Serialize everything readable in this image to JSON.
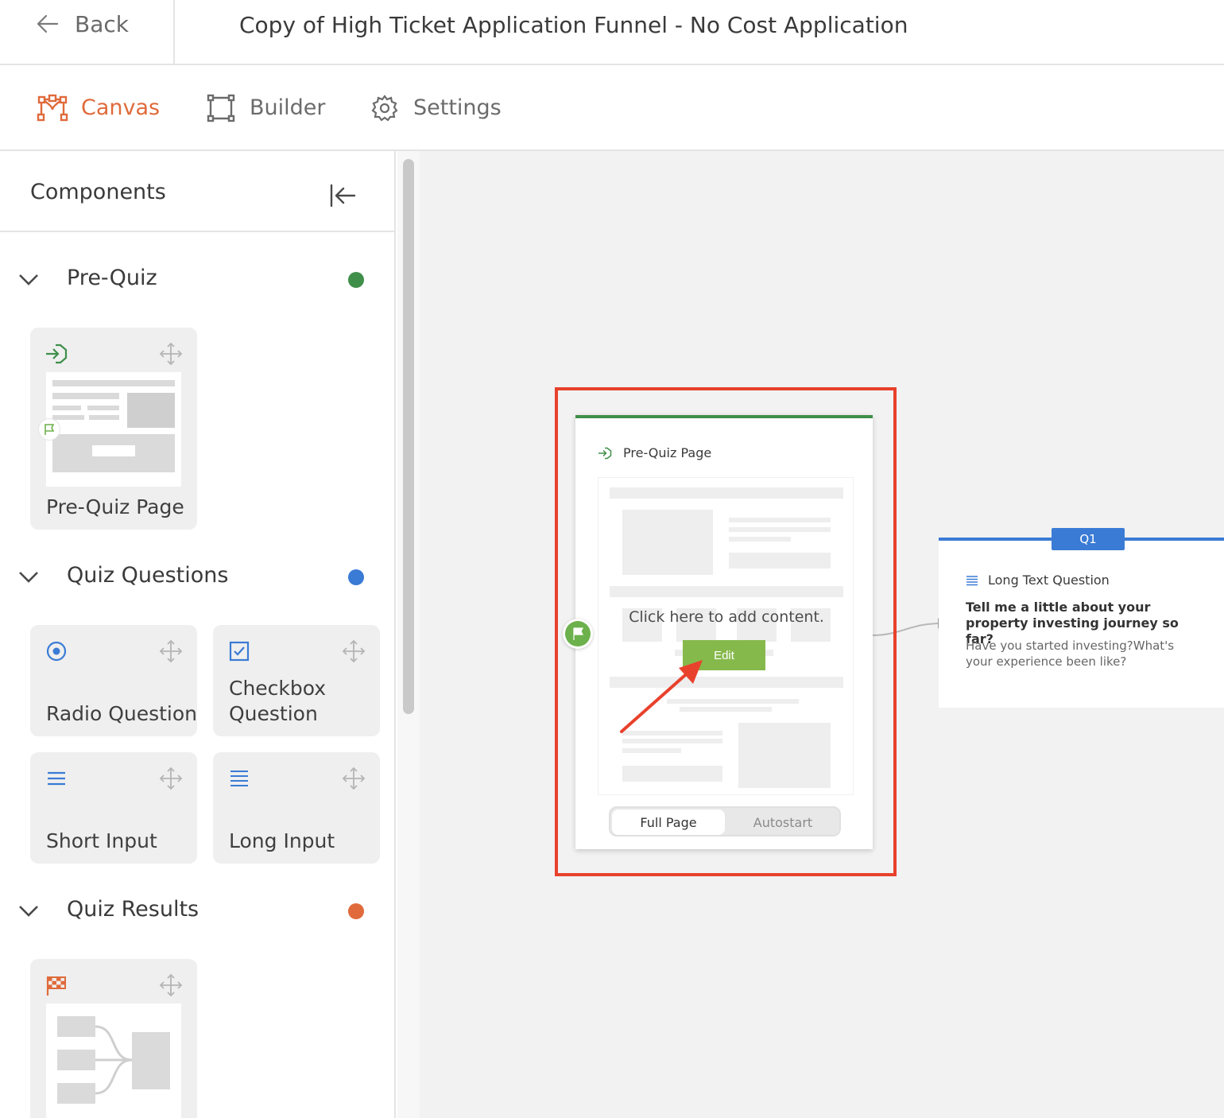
{
  "topbar": {
    "back_label": "Back",
    "title": "Copy of High Ticket Application Funnel - No Cost Application"
  },
  "tabs": [
    {
      "label": "Canvas",
      "icon": "canvas-icon",
      "active": true
    },
    {
      "label": "Builder",
      "icon": "builder-icon",
      "active": false
    },
    {
      "label": "Settings",
      "icon": "gear-icon",
      "active": false
    }
  ],
  "sidebar": {
    "heading": "Components",
    "sections": [
      {
        "label": "Pre-Quiz",
        "color": "#3f8f4a",
        "items": [
          {
            "label": "Pre-Quiz Page",
            "icon": "enter-icon"
          }
        ]
      },
      {
        "label": "Quiz Questions",
        "color": "#3a7bd5",
        "items": [
          {
            "label": "Radio Question",
            "icon": "radio-icon"
          },
          {
            "label": "Checkbox Question",
            "icon": "checkbox-icon"
          },
          {
            "label": "Short Input",
            "icon": "short-lines-icon"
          },
          {
            "label": "Long Input",
            "icon": "long-lines-icon"
          }
        ]
      },
      {
        "label": "Quiz Results",
        "color": "#e06a3b",
        "items": [
          {
            "label": "",
            "icon": "checkered-flag-icon"
          }
        ]
      }
    ]
  },
  "canvas": {
    "prequiz_node": {
      "title": "Pre-Quiz Page",
      "cta_text": "Click here to add content.",
      "edit_label": "Edit",
      "toggle": {
        "options": [
          "Full Page",
          "Autostart"
        ],
        "selected": "Full Page"
      }
    },
    "q1_node": {
      "badge": "Q1",
      "type_label": "Long Text Question",
      "question": "Tell me a little about your property investing journey so far?",
      "description": "Have you started investing?What's your experience been like?"
    }
  },
  "colors": {
    "accent_orange": "#e06a3b",
    "green": "#3f8f4a",
    "edit_green": "#86b94b",
    "blue": "#3a7bd5",
    "highlight_red": "#e8412c"
  }
}
